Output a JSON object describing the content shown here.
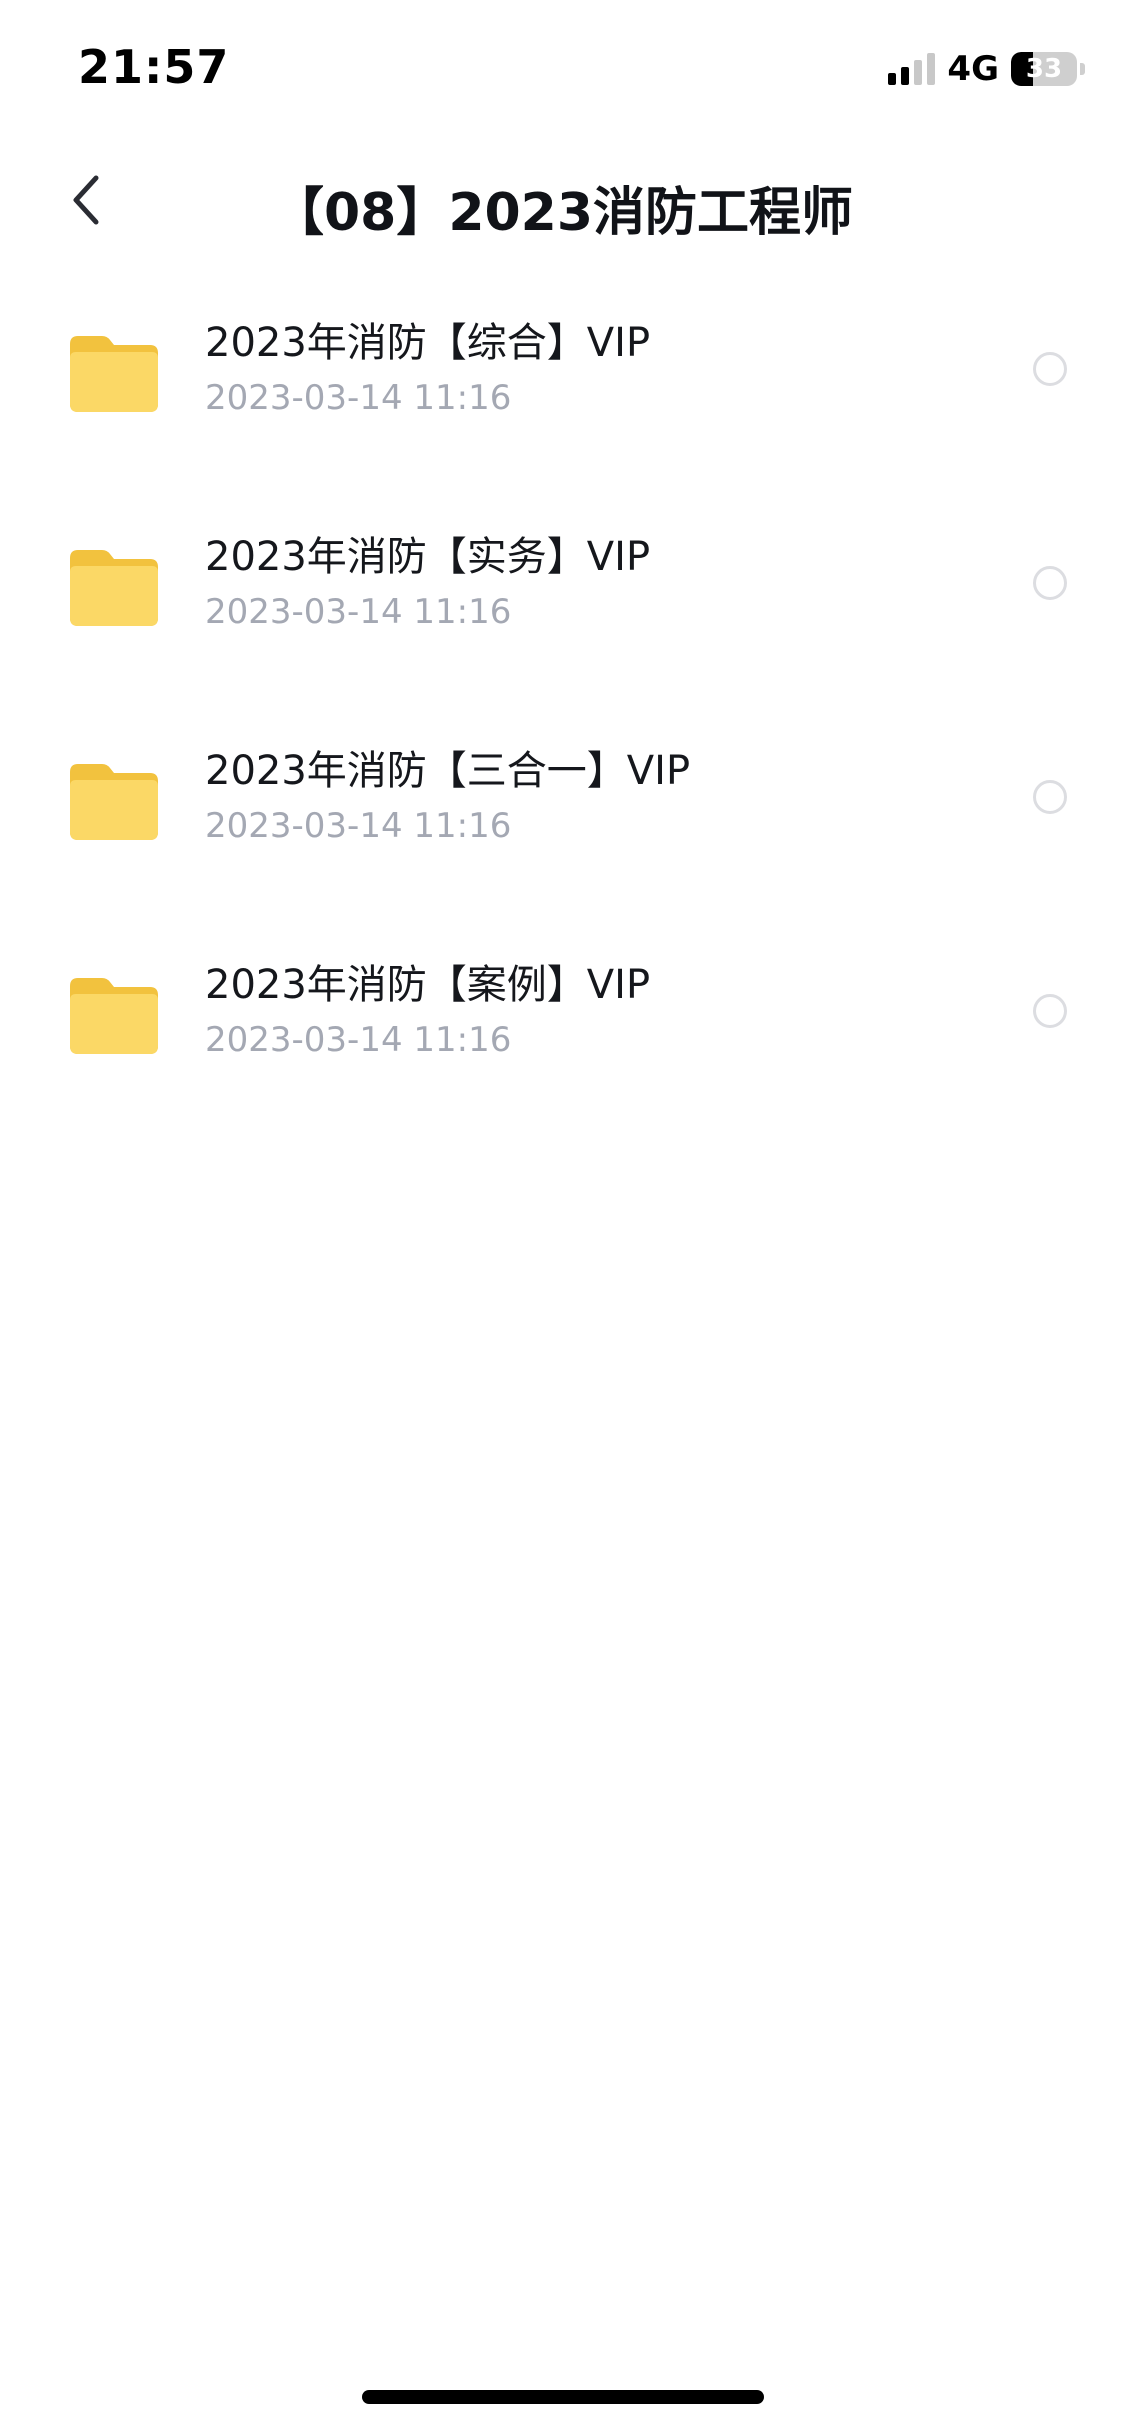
{
  "status_bar": {
    "time": "21:57",
    "network": "4G",
    "battery_level": 33,
    "battery_text": "33"
  },
  "nav": {
    "back_icon": "chevron-left-icon",
    "title": "【08】2023消防工程师"
  },
  "items": [
    {
      "name": "2023年消防【综合】VIP",
      "date": "2023-03-14 11:16",
      "icon": "folder-icon",
      "selected": false
    },
    {
      "name": "2023年消防【实务】VIP",
      "date": "2023-03-14 11:16",
      "icon": "folder-icon",
      "selected": false
    },
    {
      "name": "2023年消防【三合一】VIP",
      "date": "2023-03-14 11:16",
      "icon": "folder-icon",
      "selected": false
    },
    {
      "name": "2023年消防【案例】VIP",
      "date": "2023-03-14 11:16",
      "icon": "folder-icon",
      "selected": false
    }
  ],
  "colors": {
    "folder_back": "#f2c23e",
    "folder_front": "#fbd866",
    "date_text": "#a4a8b3",
    "circle_border": "#dcdde1"
  }
}
